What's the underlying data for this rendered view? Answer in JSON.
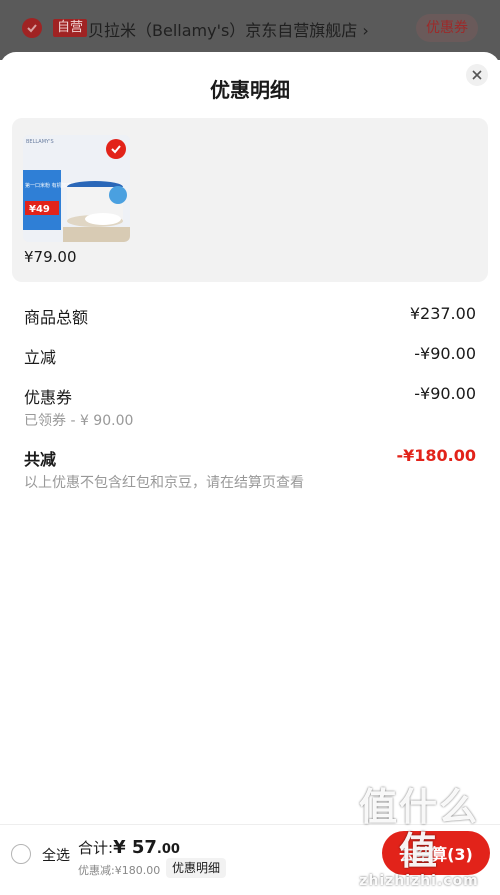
{
  "header": {
    "self_badge": "自营",
    "shop_name": "贝拉米（Bellamy's）京东自营旗舰店 ›",
    "coupon_label": "优惠券"
  },
  "sheet": {
    "title": "优惠明细",
    "product": {
      "price": "¥79.00",
      "thumb_brand": "BELLAMY'S",
      "thumb_badge_price": "¥49",
      "thumb_tagline": "第一口米粉 有机加高铁"
    },
    "rows": {
      "subtotal": {
        "label": "商品总额",
        "value": "¥237.00"
      },
      "instant": {
        "label": "立减",
        "value": "-¥90.00"
      },
      "coupon": {
        "label": "优惠券",
        "value": "-¥90.00",
        "sub": "已领券 - ¥ 90.00"
      },
      "total_off": {
        "label": "共减",
        "value": "-¥180.00",
        "note": "以上优惠不包含红包和京豆，请在结算页查看"
      }
    }
  },
  "bottom": {
    "select_all": "全选",
    "total_prefix": "合计:",
    "total_currency": "¥ ",
    "total_amount": "57",
    "total_cents": ".00",
    "discount": "优惠减:¥180.00",
    "detail_chip": "优惠明细",
    "checkout": "去结算(3)"
  },
  "watermark": {
    "big": "值什么值",
    "small": "zhizhizhi.com"
  },
  "colors": {
    "accent": "#e2231a",
    "muted": "#999999"
  },
  "icons": [
    "check-icon",
    "close-icon",
    "radio-icon"
  ]
}
